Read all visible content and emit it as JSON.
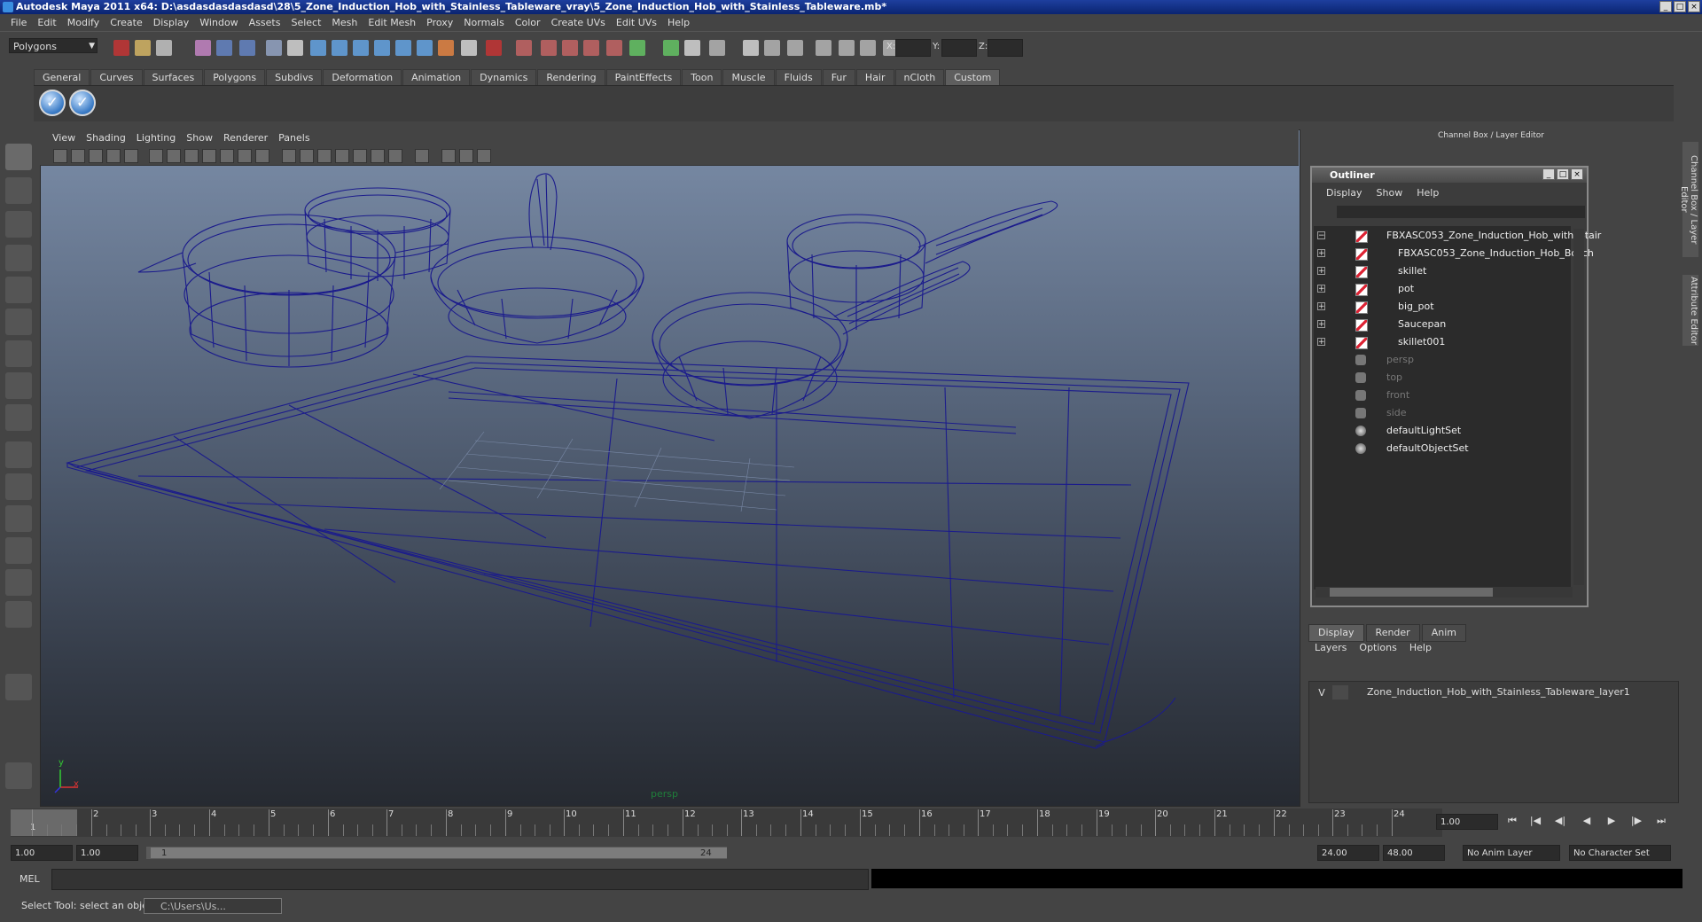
{
  "window": {
    "title": "Autodesk Maya 2011 x64: D:\\asdasdasdasdasd\\28\\5_Zone_Induction_Hob_with_Stainless_Tableware_vray\\5_Zone_Induction_Hob_with_Stainless_Tableware.mb*"
  },
  "menus": [
    "File",
    "Edit",
    "Modify",
    "Create",
    "Display",
    "Window",
    "Assets",
    "Select",
    "Mesh",
    "Edit Mesh",
    "Proxy",
    "Normals",
    "Color",
    "Create UVs",
    "Edit UVs",
    "Help"
  ],
  "toolbar": {
    "mode": "Polygons",
    "x_label": "X:",
    "y_label": "Y:",
    "z_label": "Z:"
  },
  "shelf": {
    "tabs": [
      "General",
      "Curves",
      "Surfaces",
      "Polygons",
      "Subdivs",
      "Deformation",
      "Animation",
      "Dynamics",
      "Rendering",
      "PaintEffects",
      "Toon",
      "Muscle",
      "Fluids",
      "Fur",
      "Hair",
      "nCloth",
      "Custom"
    ],
    "active": "Custom",
    "buttons": [
      "✓",
      "✓"
    ]
  },
  "viewport": {
    "menu": [
      "View",
      "Shading",
      "Lighting",
      "Show",
      "Renderer",
      "Panels"
    ],
    "camera_label": "persp",
    "axis_x": "x",
    "axis_y": "y",
    "wire_color": "#1b1b8c"
  },
  "channel_box": {
    "title": "Channel Box / Layer Editor"
  },
  "outliner": {
    "title": "Outliner",
    "menu": [
      "Display",
      "Show",
      "Help"
    ],
    "items": [
      {
        "label": "FBXASC053_Zone_Induction_Hob_with_Stair",
        "icon": "mesh-icon",
        "expand": "−",
        "child": false,
        "dim": false
      },
      {
        "label": "FBXASC053_Zone_Induction_Hob_Bosch",
        "icon": "mesh-icon",
        "expand": "+",
        "child": true,
        "dim": false
      },
      {
        "label": "skillet",
        "icon": "mesh-icon",
        "expand": "+",
        "child": true,
        "dim": false
      },
      {
        "label": "pot",
        "icon": "mesh-icon",
        "expand": "+",
        "child": true,
        "dim": false
      },
      {
        "label": "big_pot",
        "icon": "mesh-icon",
        "expand": "+",
        "child": true,
        "dim": false
      },
      {
        "label": "Saucepan",
        "icon": "mesh-icon",
        "expand": "+",
        "child": true,
        "dim": false
      },
      {
        "label": "skillet001",
        "icon": "mesh-icon",
        "expand": "+",
        "child": true,
        "dim": false
      },
      {
        "label": "persp",
        "icon": "camera-icon",
        "expand": "",
        "child": false,
        "dim": true
      },
      {
        "label": "top",
        "icon": "camera-icon",
        "expand": "",
        "child": false,
        "dim": true
      },
      {
        "label": "front",
        "icon": "camera-icon",
        "expand": "",
        "child": false,
        "dim": true
      },
      {
        "label": "side",
        "icon": "camera-icon",
        "expand": "",
        "child": false,
        "dim": true
      },
      {
        "label": "defaultLightSet",
        "icon": "set-icon",
        "expand": "",
        "child": false,
        "dim": false
      },
      {
        "label": "defaultObjectSet",
        "icon": "set-icon",
        "expand": "",
        "child": false,
        "dim": false
      }
    ]
  },
  "layer_editor": {
    "tabs": [
      "Display",
      "Render",
      "Anim"
    ],
    "active": "Display",
    "menu": [
      "Layers",
      "Options",
      "Help"
    ],
    "layers": [
      {
        "visible": "V",
        "name": "Zone_Induction_Hob_with_Stainless_Tableware_layer1"
      }
    ]
  },
  "timeline": {
    "ticks": [
      "1",
      "2",
      "3",
      "4",
      "5",
      "6",
      "7",
      "8",
      "9",
      "10",
      "11",
      "12",
      "13",
      "14",
      "15",
      "16",
      "17",
      "18",
      "19",
      "20",
      "21",
      "22",
      "23",
      "24"
    ],
    "current_frame": "1",
    "current_frame_field": "1.00"
  },
  "range": {
    "start": "1.00",
    "start2": "1.00",
    "slider_start": "1",
    "slider_end": "24",
    "end": "24.00",
    "end2": "48.00",
    "anim_layer": "No Anim Layer",
    "character_set": "No Character Set"
  },
  "command_line": {
    "label": "MEL"
  },
  "status": {
    "help_text": "Select Tool: select an object",
    "taskbar_item": "C:\\Users\\Us..."
  }
}
